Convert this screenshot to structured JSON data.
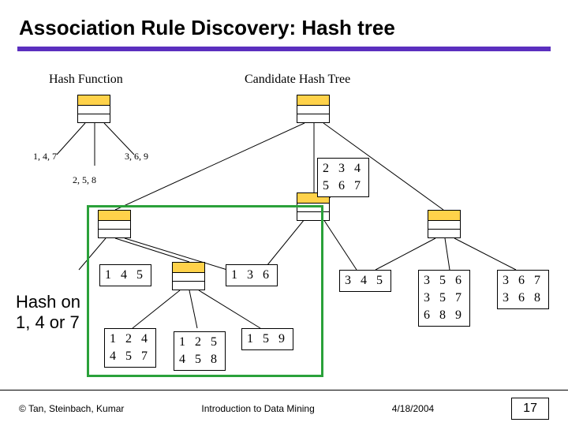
{
  "title": "Association Rule Discovery: Hash tree",
  "labels": {
    "hashfn": "Hash Function",
    "tree": "Candidate Hash Tree",
    "e147": "1, 4, 7",
    "e369": "3, 6, 9",
    "e258": "2, 5, 8",
    "hashon1": "Hash on",
    "hashon2": "1, 4 or 7"
  },
  "leaves": {
    "L234_567": [
      "2 3 4",
      "5 6 7"
    ],
    "L145": [
      "1 4 5"
    ],
    "L136": [
      "1 3 6"
    ],
    "L345": [
      "3 4 5"
    ],
    "L356_357_689": [
      "3 5 6",
      "3 5 7",
      "6 8 9"
    ],
    "L367_368": [
      "3 6 7",
      "3 6 8"
    ],
    "L124_457": [
      "1 2 4",
      "4 5 7"
    ],
    "L125_458": [
      "1 2 5",
      "4 5 8"
    ],
    "L159": [
      "1 5 9"
    ]
  },
  "footer": {
    "copyright": "© Tan, Steinbach, Kumar",
    "center": "Introduction to Data Mining",
    "date": "4/18/2004",
    "page": "17"
  }
}
